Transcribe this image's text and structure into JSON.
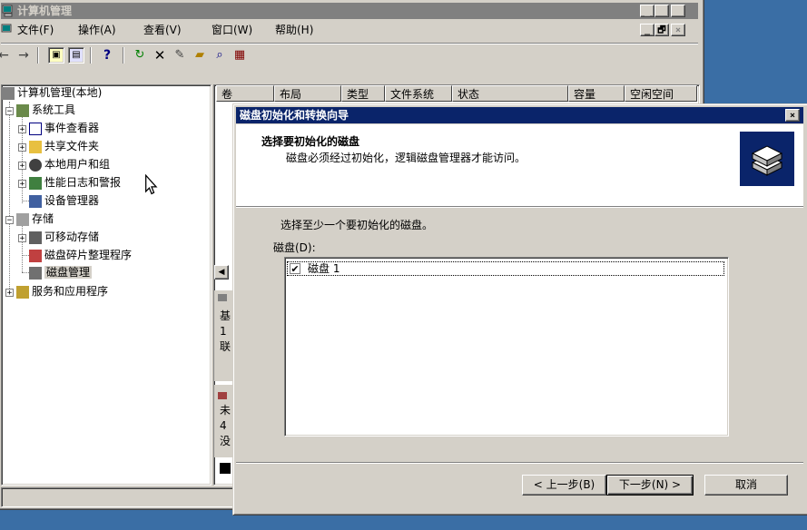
{
  "main_window": {
    "title": "计算机管理",
    "menu": [
      "文件(F)",
      "操作(A)",
      "查看(V)",
      "窗口(W)",
      "帮助(H)"
    ],
    "caption_buttons": [
      "_",
      "□",
      "×"
    ],
    "mdi_buttons": [
      "_",
      "🗗",
      "×"
    ]
  },
  "tree": {
    "root": "计算机管理(本地)",
    "system_tools": "系统工具",
    "event_viewer": "事件查看器",
    "shared_folders": "共享文件夹",
    "local_users": "本地用户和组",
    "perf_logs": "性能日志和警报",
    "device_manager": "设备管理器",
    "storage": "存储",
    "removable_storage": "可移动存储",
    "defrag": "磁盘碎片整理程序",
    "disk_management": "磁盘管理",
    "services_apps": "服务和应用程序"
  },
  "columns": [
    "卷",
    "布局",
    "类型",
    "文件系统",
    "状态",
    "容量",
    "空闲空间"
  ],
  "disk_fragments": {
    "row1": [
      "基",
      "1",
      "联"
    ],
    "row2": [
      "未",
      "4",
      "没"
    ]
  },
  "dialog": {
    "title": "磁盘初始化和转换向导",
    "close": "×",
    "heading": "选择要初始化的磁盘",
    "subheading": "磁盘必须经过初始化，逻辑磁盘管理器才能访问。",
    "instruction": "选择至少一个要初始化的磁盘。",
    "list_label": "磁盘(D):",
    "disks": [
      {
        "label": "磁盘 1",
        "checked": true
      }
    ],
    "buttons": {
      "back": "< 上一步(B)",
      "next": "下一步(N) >",
      "cancel": "取消"
    }
  }
}
